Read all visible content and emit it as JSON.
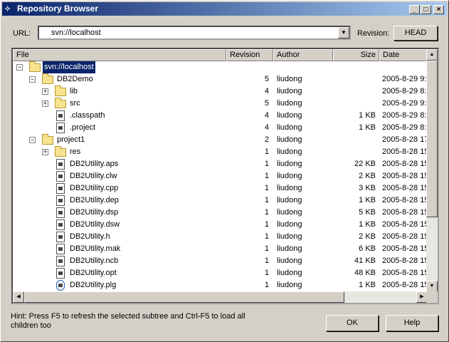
{
  "window": {
    "title": "Repository Browser"
  },
  "toolbar": {
    "url_label": "URL:",
    "url_value": "svn://localhost",
    "revision_label": "Revision:",
    "head_button": "HEAD"
  },
  "columns": [
    "File",
    "Revision",
    "Author",
    "Size",
    "Date"
  ],
  "rows": [
    {
      "depth": 0,
      "exp": "−",
      "icon": "folder",
      "name": "svn://localhost",
      "rev": "",
      "author": "",
      "size": "",
      "date": "",
      "selected": true
    },
    {
      "depth": 1,
      "exp": "−",
      "icon": "folder",
      "name": "DB2Demo",
      "rev": "5",
      "author": "liudong",
      "size": "",
      "date": "2005-8-29 9:"
    },
    {
      "depth": 2,
      "exp": "+",
      "icon": "folder",
      "name": "lib",
      "rev": "4",
      "author": "liudong",
      "size": "",
      "date": "2005-8-29 8:"
    },
    {
      "depth": 2,
      "exp": "+",
      "icon": "folder",
      "name": "src",
      "rev": "5",
      "author": "liudong",
      "size": "",
      "date": "2005-8-29 9:"
    },
    {
      "depth": 2,
      "exp": "",
      "icon": "file",
      "name": ".classpath",
      "rev": "4",
      "author": "liudong",
      "size": "1 KB",
      "date": "2005-8-29 8:"
    },
    {
      "depth": 2,
      "exp": "",
      "icon": "file",
      "name": ".project",
      "rev": "4",
      "author": "liudong",
      "size": "1 KB",
      "date": "2005-8-29 8:"
    },
    {
      "depth": 1,
      "exp": "−",
      "icon": "folder",
      "name": "project1",
      "rev": "2",
      "author": "liudong",
      "size": "",
      "date": "2005-8-28 17"
    },
    {
      "depth": 2,
      "exp": "+",
      "icon": "folder",
      "name": "res",
      "rev": "1",
      "author": "liudong",
      "size": "",
      "date": "2005-8-28 15"
    },
    {
      "depth": 2,
      "exp": "",
      "icon": "file",
      "name": "DB2Utility.aps",
      "rev": "1",
      "author": "liudong",
      "size": "22 KB",
      "date": "2005-8-28 15"
    },
    {
      "depth": 2,
      "exp": "",
      "icon": "file",
      "name": "DB2Utility.clw",
      "rev": "1",
      "author": "liudong",
      "size": "2 KB",
      "date": "2005-8-28 15"
    },
    {
      "depth": 2,
      "exp": "",
      "icon": "file",
      "name": "DB2Utility.cpp",
      "rev": "1",
      "author": "liudong",
      "size": "3 KB",
      "date": "2005-8-28 15"
    },
    {
      "depth": 2,
      "exp": "",
      "icon": "file",
      "name": "DB2Utility.dep",
      "rev": "1",
      "author": "liudong",
      "size": "1 KB",
      "date": "2005-8-28 15"
    },
    {
      "depth": 2,
      "exp": "",
      "icon": "file",
      "name": "DB2Utility.dsp",
      "rev": "1",
      "author": "liudong",
      "size": "5 KB",
      "date": "2005-8-28 15"
    },
    {
      "depth": 2,
      "exp": "",
      "icon": "file",
      "name": "DB2Utility.dsw",
      "rev": "1",
      "author": "liudong",
      "size": "1 KB",
      "date": "2005-8-28 15"
    },
    {
      "depth": 2,
      "exp": "",
      "icon": "file",
      "name": "DB2Utility.h",
      "rev": "1",
      "author": "liudong",
      "size": "2 KB",
      "date": "2005-8-28 15"
    },
    {
      "depth": 2,
      "exp": "",
      "icon": "file",
      "name": "DB2Utility.mak",
      "rev": "1",
      "author": "liudong",
      "size": "6 KB",
      "date": "2005-8-28 15"
    },
    {
      "depth": 2,
      "exp": "",
      "icon": "file",
      "name": "DB2Utility.ncb",
      "rev": "1",
      "author": "liudong",
      "size": "41 KB",
      "date": "2005-8-28 15"
    },
    {
      "depth": 2,
      "exp": "",
      "icon": "file",
      "name": "DB2Utility.opt",
      "rev": "1",
      "author": "liudong",
      "size": "48 KB",
      "date": "2005-8-28 15"
    },
    {
      "depth": 2,
      "exp": "",
      "icon": "ie",
      "name": "DB2Utility.plg",
      "rev": "1",
      "author": "liudong",
      "size": "1 KB",
      "date": "2005-8-28 15"
    }
  ],
  "hint": "Hint: Press F5 to refresh the selected subtree and Ctrl-F5 to load all children too",
  "buttons": {
    "ok": "OK",
    "help": "Help"
  },
  "colors": {
    "titlebar_start": "#0a246a",
    "titlebar_end": "#a6caf0",
    "selection": "#0a246a"
  }
}
